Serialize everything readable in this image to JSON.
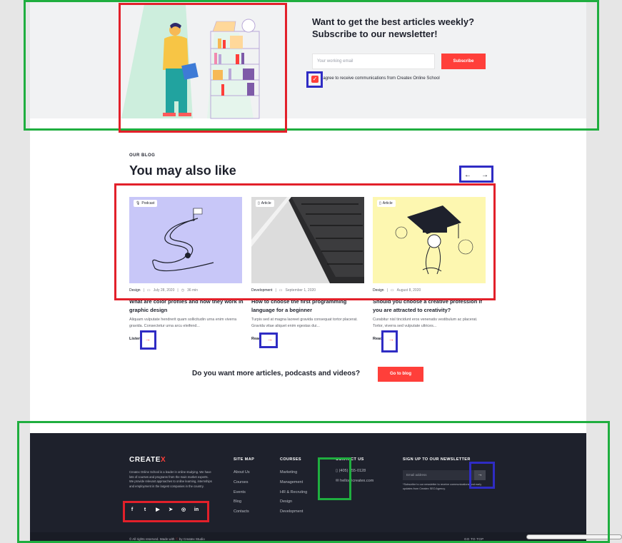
{
  "newsletter": {
    "title_line1": "Want to get the best articles weekly?",
    "title_line2": "Subscribe to our newsletter!",
    "email_placeholder": "Your working email",
    "subscribe_label": "Subscribe",
    "agree_text": "I agree to receive communications from Createx Online School",
    "agree_checked": true
  },
  "blog": {
    "eyebrow": "OUR BLOG",
    "title": "You may also like",
    "prev_arrow": "←",
    "next_arrow": "→",
    "cards": [
      {
        "badge": "Podcast",
        "badge_icon": "microphone-icon",
        "category": "Design",
        "date": "July 28, 2020",
        "duration": "36 min",
        "title": "What are color profiles and how they work in graphic design",
        "excerpt": "Aliquam vulputate hendrerit quam sollicitudin urna enim viverra gravida. Consectetur urna arcu eleifend...",
        "link": "Listen",
        "bg": "#c8c7f8"
      },
      {
        "badge": "Article",
        "badge_icon": "file-icon",
        "category": "Development",
        "date": "September 1, 2020",
        "title": "How to choose the first programming language for a beginner",
        "excerpt": "Turpis sed at magna laoreet gravida consequat tortor placerat. Gravida vitae aliquet enim egestas dui...",
        "link": "Read",
        "bg": "#e8e8e8"
      },
      {
        "badge": "Article",
        "badge_icon": "file-icon",
        "category": "Design",
        "date": "August 8, 2020",
        "title": "Should you choose a creative profession if you are attracted to creativity?",
        "excerpt": "Curabitur nisl tincidunt eros venenatis vestibulum ac placerat. Tortor, viverra sed vulputate ultrices...",
        "link": "Read",
        "bg": "#fdf7b0"
      }
    ],
    "more_question": "Do you want more articles, podcasts and videos?",
    "more_button": "Go to blog"
  },
  "footer": {
    "logo_main": "CREATE",
    "logo_accent": "X",
    "about": "Createx Online School is a leader in online studying. We have lots of courses and programs from the main market experts. We provide relevant approaches to online learning, internships and employment in the largest companies in the country.",
    "socials": [
      "facebook-icon",
      "twitter-icon",
      "youtube-icon",
      "telegram-icon",
      "instagram-icon",
      "linkedin-icon"
    ],
    "social_glyphs": [
      "f",
      "t",
      "▶",
      "➤",
      "◎",
      "in"
    ],
    "sitemap_title": "SITE MAP",
    "sitemap": [
      "About Us",
      "Courses",
      "Events",
      "Blog",
      "Contacts"
    ],
    "courses_title": "COURSES",
    "courses": [
      "Marketing",
      "Management",
      "HR & Recruting",
      "Design",
      "Development"
    ],
    "contact_title": "CONTACT US",
    "phone": "(405) 555-0128",
    "email": "hello@createx.com",
    "signup_title": "SIGN UP TO OUR NEWSLETTER",
    "signup_placeholder": "Email address",
    "signup_note": "*Subscribe to our newsletter to receive communications and early updates from Createx SEO Agency.",
    "copyright_pre": "© All rights reserved. Made with",
    "copyright_post": "by Createx Studio",
    "goto_top": "GO TO TOP"
  },
  "colors": {
    "accent": "#ff3f3a",
    "dark": "#1e212c",
    "highlight_green": "#1fae3f",
    "highlight_red": "#e2202a",
    "highlight_blue": "#2f2cc4"
  }
}
